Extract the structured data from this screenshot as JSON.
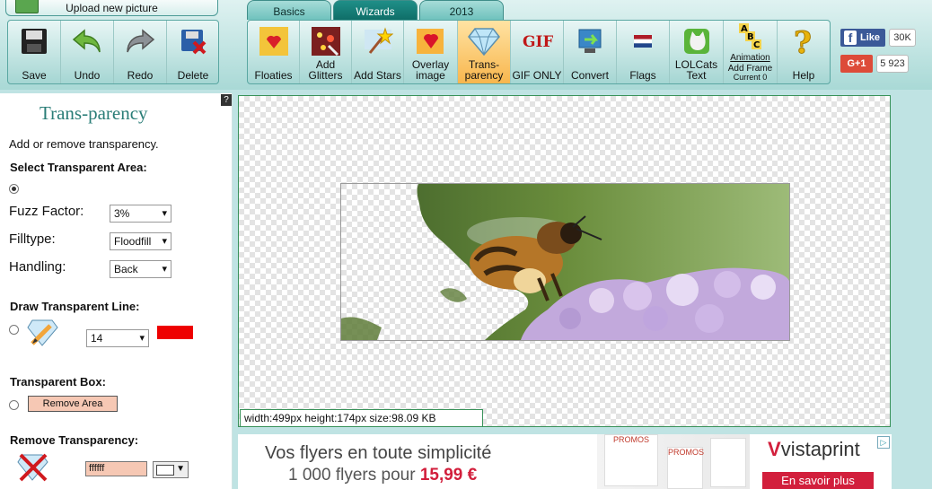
{
  "header": {
    "upload_label": "Upload new picture",
    "tabs": [
      {
        "label": "Basics",
        "active": false
      },
      {
        "label": "Wizards",
        "active": true
      },
      {
        "label": "2013",
        "active": false
      }
    ]
  },
  "toolbar_left": [
    {
      "label": "Save",
      "icon": "floppy-disk-icon"
    },
    {
      "label": "Undo",
      "icon": "undo-arrow-icon"
    },
    {
      "label": "Redo",
      "icon": "redo-arrow-icon"
    },
    {
      "label": "Delete",
      "icon": "delete-disk-icon"
    }
  ],
  "toolbar_right": [
    {
      "label_1": "Floaties",
      "label_2": "",
      "icon": "floaties-icon"
    },
    {
      "label_1": "Add",
      "label_2": "Glitters",
      "icon": "glitter-icon"
    },
    {
      "label_1": "Add Stars",
      "label_2": "",
      "icon": "stars-wand-icon"
    },
    {
      "label_1": "Overlay",
      "label_2": "image",
      "icon": "heart-overlay-icon"
    },
    {
      "label_1": "Trans-",
      "label_2": "parency",
      "icon": "diamond-icon",
      "active": true
    },
    {
      "label_1": "GIF ONLY",
      "label_2": "",
      "icon": "gif-icon"
    },
    {
      "label_1": "Convert",
      "label_2": "",
      "icon": "convert-icon"
    },
    {
      "label_1": "Flags",
      "label_2": "",
      "icon": "flag-icon"
    },
    {
      "label_1": "LOLCats",
      "label_2": "Text",
      "icon": "lolcat-icon"
    },
    {
      "label_1": "Animation",
      "label_2": "Add Frame",
      "label_3": "Current 0",
      "icon": "abc-blocks-icon"
    },
    {
      "label_1": "Help",
      "label_2": "",
      "icon": "help-question-icon"
    }
  ],
  "social": {
    "fb_label": "Like",
    "fb_count": "30K",
    "gplus_label": "G+1",
    "gplus_count": "5 923"
  },
  "panel": {
    "help_glyph": "?",
    "title": "Trans-parency",
    "intro": "Add or remove transparency.",
    "select_area_heading": "Select Transparent Area:",
    "fuzz_label": "Fuzz Factor:",
    "fuzz_value": "3%",
    "filltype_label": "Filltype:",
    "filltype_value": "Floodfill",
    "handling_label": "Handling:",
    "handling_value": "Back",
    "draw_line_heading": "Draw Transparent Line:",
    "line_width_value": "14",
    "line_color": "#ee0000",
    "box_heading": "Transparent Box:",
    "remove_area_label": "Remove Area",
    "remove_heading": "Remove Transparency:",
    "remove_color_value": "ffffff"
  },
  "canvas": {
    "info": "width:499px  height:174px  size:98.09 KB"
  },
  "ad": {
    "headline": "Vos flyers en toute simplicité",
    "sub_text": "1 000 flyers pour",
    "price": "15,99 €",
    "promo_1": "PROMOS",
    "promo_2": "PROMOS",
    "brand": "vistaprint",
    "cta": "En savoir plus"
  },
  "colors": {
    "accent": "#2a7d77",
    "active_tool": "#f8b64d",
    "tab_active": "#0f6e68"
  }
}
